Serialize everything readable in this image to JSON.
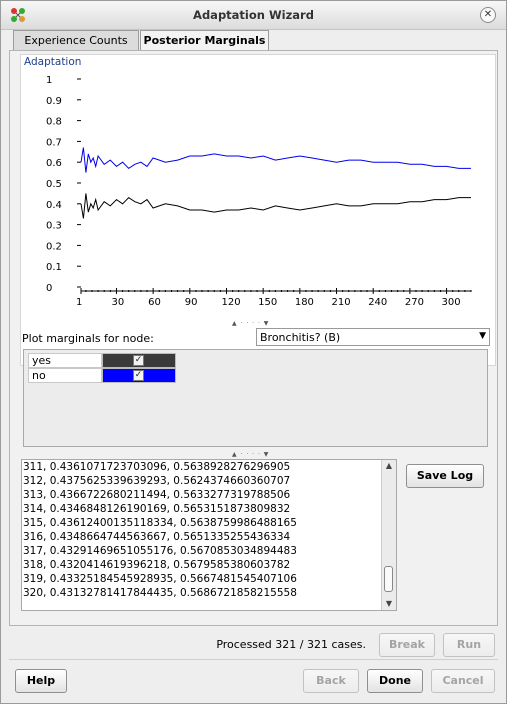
{
  "window": {
    "title": "Adaptation Wizard",
    "close_symbol": "✕"
  },
  "tabs": [
    {
      "label": "Experience Counts",
      "active": false
    },
    {
      "label": "Posterior Marginals",
      "active": true
    }
  ],
  "chart_data": {
    "type": "line",
    "title": "Adaptation",
    "xlabel": "",
    "ylabel": "",
    "x_ticks": [
      "1",
      "30",
      "60",
      "90",
      "120",
      "150",
      "180",
      "210",
      "240",
      "270",
      "300"
    ],
    "y_ticks": [
      "0",
      "0.1",
      "0.2",
      "0.3",
      "0.4",
      "0.5",
      "0.6",
      "0.7",
      "0.8",
      "0.9",
      "1"
    ],
    "ylim": [
      0,
      1
    ],
    "xlim": [
      1,
      320
    ],
    "grid": false,
    "series": [
      {
        "name": "yes",
        "color": "#000000",
        "x": [
          1,
          3,
          5,
          7,
          9,
          11,
          13,
          15,
          20,
          25,
          30,
          35,
          40,
          45,
          50,
          55,
          60,
          70,
          80,
          90,
          100,
          110,
          120,
          130,
          140,
          150,
          160,
          170,
          180,
          190,
          200,
          210,
          220,
          230,
          240,
          250,
          260,
          270,
          280,
          290,
          300,
          310,
          320
        ],
        "values": [
          0.4,
          0.33,
          0.45,
          0.36,
          0.4,
          0.38,
          0.42,
          0.37,
          0.41,
          0.39,
          0.42,
          0.4,
          0.43,
          0.41,
          0.4,
          0.42,
          0.38,
          0.4,
          0.39,
          0.37,
          0.37,
          0.36,
          0.37,
          0.37,
          0.38,
          0.37,
          0.39,
          0.38,
          0.37,
          0.38,
          0.39,
          0.4,
          0.39,
          0.39,
          0.4,
          0.4,
          0.4,
          0.41,
          0.41,
          0.42,
          0.42,
          0.43,
          0.43
        ]
      },
      {
        "name": "no",
        "color": "#0000ee",
        "x": [
          1,
          3,
          5,
          7,
          9,
          11,
          13,
          15,
          20,
          25,
          30,
          35,
          40,
          45,
          50,
          55,
          60,
          70,
          80,
          90,
          100,
          110,
          120,
          130,
          140,
          150,
          160,
          170,
          180,
          190,
          200,
          210,
          220,
          230,
          240,
          250,
          260,
          270,
          280,
          290,
          300,
          310,
          320
        ],
        "values": [
          0.6,
          0.67,
          0.55,
          0.64,
          0.6,
          0.62,
          0.58,
          0.63,
          0.59,
          0.61,
          0.58,
          0.6,
          0.57,
          0.59,
          0.6,
          0.58,
          0.62,
          0.6,
          0.61,
          0.63,
          0.63,
          0.64,
          0.63,
          0.63,
          0.62,
          0.63,
          0.61,
          0.62,
          0.63,
          0.62,
          0.61,
          0.6,
          0.61,
          0.61,
          0.6,
          0.6,
          0.6,
          0.59,
          0.59,
          0.58,
          0.58,
          0.57,
          0.57
        ]
      }
    ]
  },
  "node_selector": {
    "label": "Plot marginals for node:",
    "selected": "Bronchitis? (B)"
  },
  "states": [
    {
      "name": "yes",
      "color": "#3a3a3a",
      "checked": true
    },
    {
      "name": "no",
      "color": "#0000ff",
      "checked": true
    }
  ],
  "log": {
    "lines": [
      "311, 0.4361071723703096, 0.5638928276296905",
      "312, 0.4375625339639293, 0.5624374660360707",
      "313, 0.4366722680211494, 0.5633277319788506",
      "314, 0.434684812619016​9, 0.5653151873809832",
      "315, 0.43612400135118334, 0.5638759986488165",
      "316, 0.4348664744563667, 0.5651335255436334",
      "317, 0.43291469651055176, 0.5670853034894483",
      "318, 0.4320414619396218, 0.5679585380603782",
      "319, 0.43325184545928935, 0.5667481545407106",
      "320, 0.43132781417844435, 0.5686721858215558"
    ]
  },
  "buttons": {
    "save_log": "Save Log",
    "break": "Break",
    "run": "Run",
    "help": "Help",
    "back": "Back",
    "done": "Done",
    "cancel": "Cancel"
  },
  "status": "Processed 321 / 321 cases."
}
